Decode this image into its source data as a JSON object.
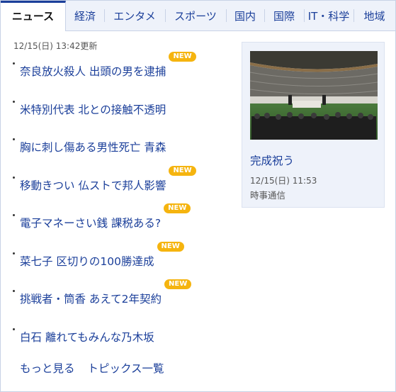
{
  "tabs": [
    {
      "label": "ニュース",
      "active": true
    },
    {
      "label": "経済",
      "active": false
    },
    {
      "label": "エンタメ",
      "active": false
    },
    {
      "label": "スポーツ",
      "active": false
    },
    {
      "label": "国内",
      "active": false
    },
    {
      "label": "国際",
      "active": false
    },
    {
      "label": "IT・科学",
      "active": false
    },
    {
      "label": "地域",
      "active": false
    }
  ],
  "updated": "12/15(日) 13:42更新",
  "badge_label": "NEW",
  "topics": [
    {
      "title": "奈良放火殺人 出頭の男を逮捕",
      "is_new": true
    },
    {
      "title": "米特別代表 北との接触不透明",
      "is_new": false
    },
    {
      "title": "胸に刺し傷ある男性死亡 青森",
      "is_new": false
    },
    {
      "title": "移動きつい 仏ストで邦人影響",
      "is_new": true
    },
    {
      "title": "電子マネーさい銭 課税ある?",
      "is_new": true
    },
    {
      "title": "菜七子 区切りの100勝達成",
      "is_new": true
    },
    {
      "title": "挑戦者・筒香 あえて2年契約",
      "is_new": true
    },
    {
      "title": "白石 離れてもみんな乃木坂",
      "is_new": false
    }
  ],
  "footer": {
    "more_label": "もっと見る",
    "topics_list_label": "トピックス一覧"
  },
  "photo_card": {
    "caption": "完成祝う",
    "date": "12/15(日) 11:53",
    "source": "時事通信"
  },
  "colors": {
    "link": "#1b3f9a",
    "tab_bg": "#eef2fa",
    "new_badge": "#f5b40f",
    "border": "#c8d2e6"
  }
}
